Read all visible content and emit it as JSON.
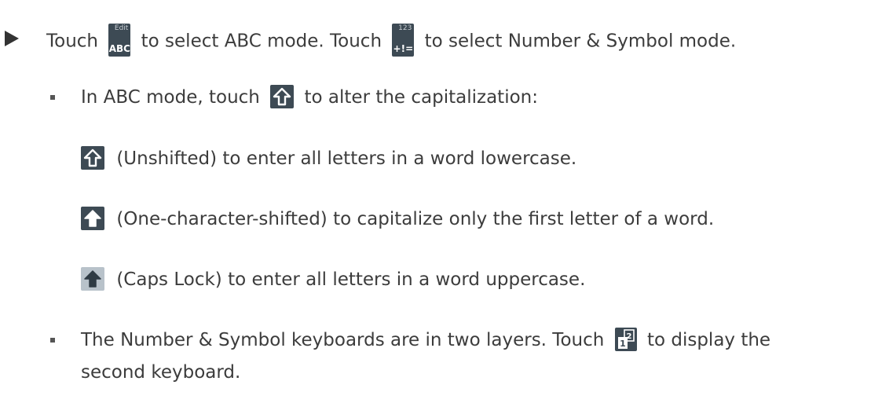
{
  "intro": {
    "touch": "Touch",
    "abc_key": {
      "sub": "Edit",
      "main": "ABC"
    },
    "abc_text": "to select ABC mode. Touch",
    "num_key": {
      "sub": "123",
      "main": "+!="
    },
    "num_text": "to select Number & Symbol mode."
  },
  "abc_mode": {
    "before": "In ABC mode, touch",
    "after": "to alter the capitalization:"
  },
  "states": [
    {
      "icon": "shift-unshifted-icon",
      "text": "(Unshifted) to enter all letters in a word lowercase."
    },
    {
      "icon": "shift-one-character-icon",
      "text": "(One-character-shifted) to capitalize only the first letter of a word."
    },
    {
      "icon": "caps-lock-icon",
      "text": "(Caps Lock) to enter all letters in a word uppercase."
    }
  ],
  "number_symbol": {
    "before": "The Number & Symbol keyboards are in two layers. Touch",
    "after": "to display the",
    "line2": "second keyboard."
  },
  "colors": {
    "key_bg": "#3d4a54",
    "caps_lock_bg": "#b8c2ca",
    "text": "#3c3c3c"
  }
}
